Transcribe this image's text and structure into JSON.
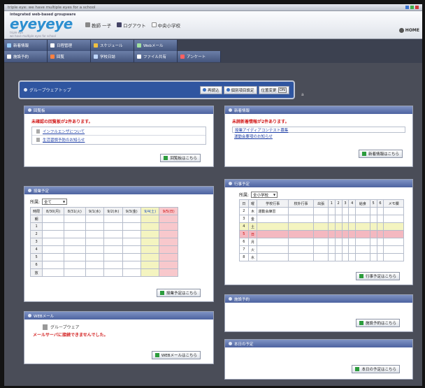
{
  "window": {
    "title": "triple eye: we have multiple eyes for a school"
  },
  "header": {
    "tagline": "integrated web-based groupware",
    "logo": "eyeyeye",
    "logo_sub_small": "triple eye",
    "logo_sub": "we have multiple eyes for school",
    "user_name": "教師 一子",
    "logout": "ログアウト",
    "school": "中央小学校",
    "home": "HOME"
  },
  "menu": {
    "row1": [
      {
        "label": "新着情報",
        "icon": "news-icon",
        "color": "#9bd0ff"
      },
      {
        "label": "日程管理",
        "icon": "calendar-icon",
        "color": "#ffffff"
      },
      {
        "label": "スケジュール",
        "icon": "clock-icon",
        "color": "#f0c040"
      },
      {
        "label": "Webメール",
        "icon": "mail-icon",
        "color": "#a0e0a0"
      }
    ],
    "row2": [
      {
        "label": "施設予約",
        "icon": "facility-icon",
        "color": "#ffffff"
      },
      {
        "label": "回覧",
        "icon": "circular-icon",
        "color": "#ff8040"
      },
      {
        "label": "学校日誌",
        "icon": "diary-icon",
        "color": "#c0d8ff"
      },
      {
        "label": "ファイル共有",
        "icon": "folder-icon",
        "color": "#ffffff"
      },
      {
        "label": "アンケート",
        "icon": "survey-icon",
        "color": "#ff6060"
      }
    ]
  },
  "group_bar": {
    "label": "グループウェアトップ",
    "btn_refresh": "再読込",
    "btn_settings": "個別項目設定",
    "btn_position": "位置変更",
    "btn_position_tag": "ON"
  },
  "panels": {
    "circular": {
      "title": "回覧板",
      "notice": "未確認の回覧板が2件あります。",
      "items": [
        "インフルエンザについて",
        "生活習慣予防のお知らせ"
      ],
      "more": "回覧板はこちら"
    },
    "news": {
      "title": "新着情報",
      "notice": "未読新着情報が2件あります。",
      "items": [
        "授業アイディアコンテスト募集",
        "運動会要項のお知らせ"
      ],
      "more": "新着情報はこちら"
    },
    "class_schedule": {
      "title": "授業予定",
      "select_label": "所属:",
      "select_value": "全て",
      "headers": [
        "時限",
        "8/30(月)",
        "8/31(火)",
        "9/1(水)",
        "9/2(木)",
        "9/3(金)",
        "9/4(土)",
        "9/5(日)"
      ],
      "rows": [
        "朝",
        "1",
        "2",
        "3",
        "4",
        "5",
        "6",
        "放"
      ],
      "more": "授業予定はこちら"
    },
    "events": {
      "title": "行事予定",
      "select_label": "所属:",
      "select_value": "全小学校",
      "headers": [
        "日",
        "曜",
        "学校行事",
        "校外行事",
        "出張",
        "1",
        "2",
        "3",
        "4",
        "給食",
        "5",
        "6",
        "メモ欄"
      ],
      "rows": [
        {
          "day": "2",
          "dow": "木",
          "event": "運動会練習"
        },
        {
          "day": "3",
          "dow": "金",
          "event": ""
        },
        {
          "day": "4",
          "dow": "土",
          "event": ""
        },
        {
          "day": "5",
          "dow": "日",
          "event": ""
        },
        {
          "day": "6",
          "dow": "月",
          "event": ""
        },
        {
          "day": "7",
          "dow": "火",
          "event": ""
        },
        {
          "day": "8",
          "dow": "水",
          "event": ""
        }
      ],
      "more": "行事予定はこちら"
    },
    "facility": {
      "title": "施設予約",
      "more": "施設予約はこちら"
    },
    "webmail": {
      "title": "WEBメール",
      "app_label": "グループウェア",
      "error": "メールサーバに接続できませんでした。",
      "more": "WEBメールはこちら"
    },
    "today": {
      "title": "本日の予定",
      "more": "本日の予定はこちら"
    }
  },
  "colors": {
    "saturday": "#f4f4c0",
    "sunday": "#f8c8cc",
    "today_row": "#f4b8c0"
  }
}
